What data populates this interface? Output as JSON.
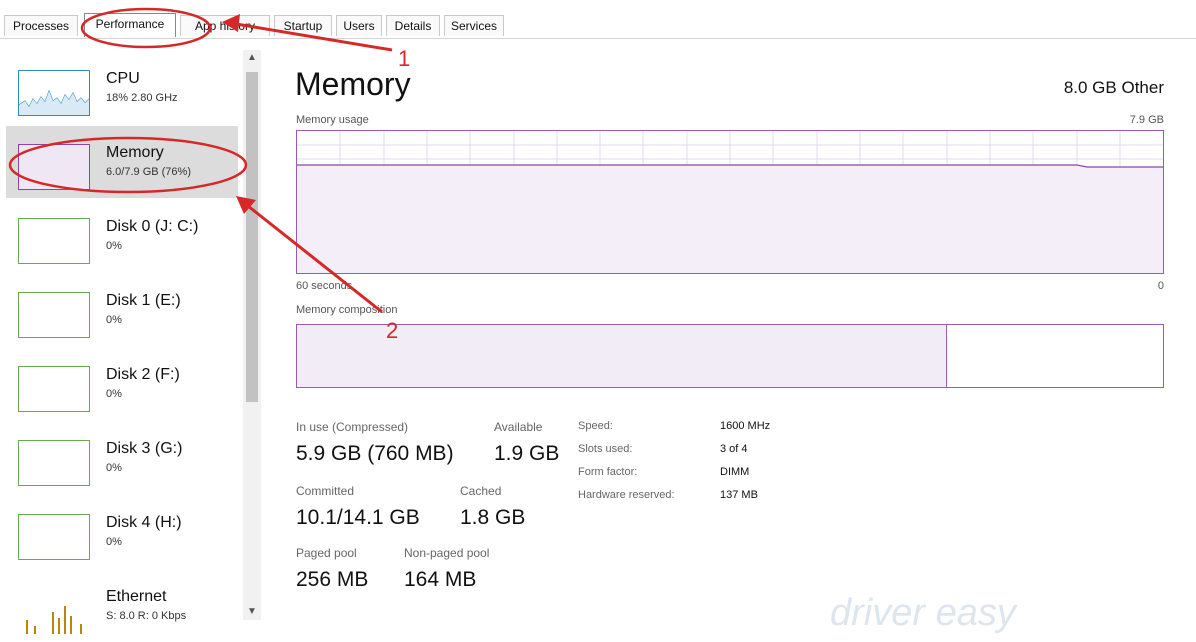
{
  "tabs": [
    {
      "label": "Processes"
    },
    {
      "label": "Performance"
    },
    {
      "label": "App history"
    },
    {
      "label": "Startup"
    },
    {
      "label": "Users"
    },
    {
      "label": "Details"
    },
    {
      "label": "Services"
    }
  ],
  "sidebar": {
    "items": [
      {
        "title": "CPU",
        "sub": "18% 2.80 GHz"
      },
      {
        "title": "Memory",
        "sub": "6.0/7.9 GB (76%)"
      },
      {
        "title": "Disk 0 (J: C:)",
        "sub": "0%"
      },
      {
        "title": "Disk 1 (E:)",
        "sub": "0%"
      },
      {
        "title": "Disk 2 (F:)",
        "sub": "0%"
      },
      {
        "title": "Disk 3 (G:)",
        "sub": "0%"
      },
      {
        "title": "Disk 4 (H:)",
        "sub": "0%"
      },
      {
        "title": "Ethernet",
        "sub": "S: 8.0 R: 0 Kbps"
      }
    ]
  },
  "main": {
    "title": "Memory",
    "total": "8.0 GB Other",
    "usage_label": "Memory usage",
    "usage_max": "7.9 GB",
    "time_label": "60 seconds",
    "time_zero": "0",
    "composition_label": "Memory composition",
    "composition_used_fraction": 0.75,
    "stats": {
      "in_use_label": "In use (Compressed)",
      "in_use_value": "5.9 GB (760 MB)",
      "available_label": "Available",
      "available_value": "1.9 GB",
      "committed_label": "Committed",
      "committed_value": "10.1/14.1 GB",
      "cached_label": "Cached",
      "cached_value": "1.8 GB",
      "paged_label": "Paged pool",
      "paged_value": "256 MB",
      "nonpaged_label": "Non-paged pool",
      "nonpaged_value": "164 MB"
    },
    "details": [
      {
        "label": "Speed:",
        "value": "1600 MHz"
      },
      {
        "label": "Slots used:",
        "value": "3 of 4"
      },
      {
        "label": "Form factor:",
        "value": "DIMM"
      },
      {
        "label": "Hardware reserved:",
        "value": "137 MB"
      }
    ]
  },
  "annotations": {
    "one": "1",
    "two": "2"
  },
  "watermark": "driver easy",
  "colors": {
    "memory": "#9b59b6",
    "cpu": "#2e8bc0",
    "disk": "#6aa84f",
    "annotation": "#d62828"
  }
}
